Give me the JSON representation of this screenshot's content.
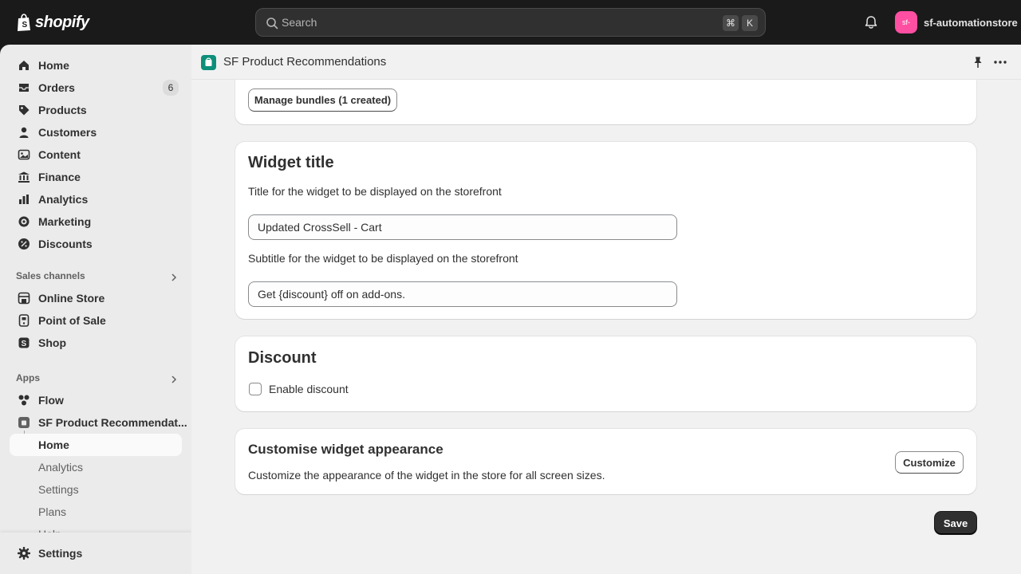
{
  "topbar": {
    "brand": "shopify",
    "search_placeholder": "Search",
    "shortcut_keys": [
      "⌘",
      "K"
    ],
    "avatar_text": "sf-",
    "store_name": "sf-automationstore",
    "avatar_color": "#ff4fa2"
  },
  "sidebar": {
    "items": [
      {
        "label": "Home",
        "icon": "home-icon"
      },
      {
        "label": "Orders",
        "icon": "orders-icon",
        "badge": "6"
      },
      {
        "label": "Products",
        "icon": "tag-icon"
      },
      {
        "label": "Customers",
        "icon": "person-icon"
      },
      {
        "label": "Content",
        "icon": "content-icon"
      },
      {
        "label": "Finance",
        "icon": "bank-icon"
      },
      {
        "label": "Analytics",
        "icon": "chart-icon"
      },
      {
        "label": "Marketing",
        "icon": "target-icon"
      },
      {
        "label": "Discounts",
        "icon": "discount-icon"
      }
    ],
    "sales_channels_heading": "Sales channels",
    "sales_channels": [
      {
        "label": "Online Store",
        "icon": "store-icon"
      },
      {
        "label": "Point of Sale",
        "icon": "pos-icon"
      },
      {
        "label": "Shop",
        "icon": "shop-icon"
      }
    ],
    "apps_heading": "Apps",
    "apps": [
      {
        "label": "Flow",
        "icon": "flow-icon"
      },
      {
        "label": "SF Product Recommendat...",
        "icon": "app-icon"
      }
    ],
    "app_subitems": [
      "Home",
      "Analytics",
      "Settings",
      "Plans",
      "Help"
    ],
    "settings_label": "Settings"
  },
  "app_header": {
    "title": "SF Product Recommendations",
    "icon_color": "#0d8f7a"
  },
  "bundles_card": {
    "button_label": "Manage bundles (1 created)"
  },
  "widget_title_card": {
    "heading": "Widget title",
    "title_help": "Title for the widget to be displayed on the storefront",
    "title_value": "Updated CrossSell - Cart",
    "subtitle_help": "Subtitle for the widget to be displayed on the storefront",
    "subtitle_value": "Get {discount} off on add-ons."
  },
  "discount_card": {
    "heading": "Discount",
    "checkbox_label": "Enable discount",
    "checked": false
  },
  "appearance_card": {
    "heading": "Customise widget appearance",
    "description": "Customize the appearance of the widget in the store for all screen sizes.",
    "button_label": "Customize"
  },
  "save_label": "Save"
}
